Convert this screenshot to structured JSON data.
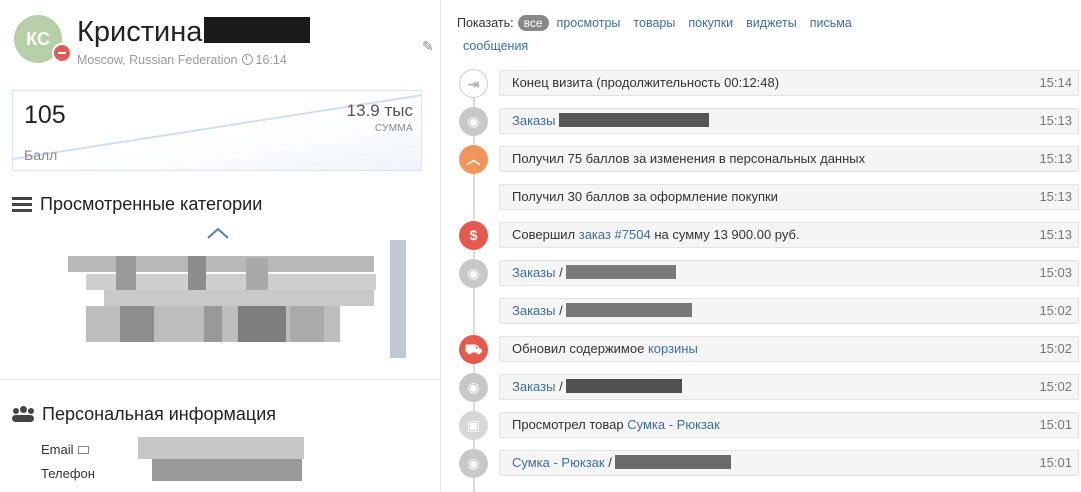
{
  "profile": {
    "initials": "КС",
    "name": "Кристина",
    "location": "Moscow, Russian Federation",
    "local_time": "16:14"
  },
  "score": {
    "points": "105",
    "points_label": "Балл",
    "sum": "13.9 тыс",
    "sum_label": "СУММА"
  },
  "sections": {
    "viewed_categories": "Просмотренные категории",
    "personal_info": "Персональная информация"
  },
  "personal": {
    "email_label": "Email",
    "phone_label": "Телефон"
  },
  "filters": {
    "label": "Показать:",
    "active": "все",
    "items": [
      "просмотры",
      "товары",
      "покупки",
      "виджеты",
      "письма",
      "сообщения"
    ]
  },
  "events": [
    {
      "icon": "exit-icon",
      "text": "Конец визита (продолжительность 00:12:48)",
      "time": "15:14"
    },
    {
      "icon": "eye-icon",
      "link": "Заказы",
      "text": "",
      "time": "15:13"
    },
    {
      "icon": "chevron-up-icon",
      "text": "Получил 75 баллов за изменения в персональных данных",
      "time": "15:13"
    },
    {
      "icon": "",
      "text": "Получил 30 баллов за оформление покупки",
      "time": "15:13"
    },
    {
      "icon": "dollar-icon",
      "prefix": "Совершил ",
      "link": "заказ #7504",
      "suffix": " на сумму 13 900.00 руб.",
      "time": "15:13"
    },
    {
      "icon": "eye-icon",
      "link": "Заказы",
      "suffix": " /",
      "time": "15:03"
    },
    {
      "icon": "",
      "link": "Заказы",
      "suffix": " /",
      "time": "15:02"
    },
    {
      "icon": "cart-icon",
      "prefix": "Обновил содержимое ",
      "link": "корзины",
      "time": "15:02"
    },
    {
      "icon": "eye-icon",
      "link": "Заказы",
      "suffix": " /",
      "time": "15:02"
    },
    {
      "icon": "box-icon",
      "prefix": "Просмотрел товар ",
      "link": "Сумка - Рюкзак",
      "time": "15:01"
    },
    {
      "icon": "eye-icon",
      "link": "Сумка - Рюкзак",
      "suffix": " /",
      "time": "15:01"
    }
  ],
  "colors": {
    "link": "#3e6f9c",
    "orange": "#f2955a",
    "red": "#e55a4d",
    "gray": "#c8c8c8",
    "avatar": "#b7cfa8"
  }
}
